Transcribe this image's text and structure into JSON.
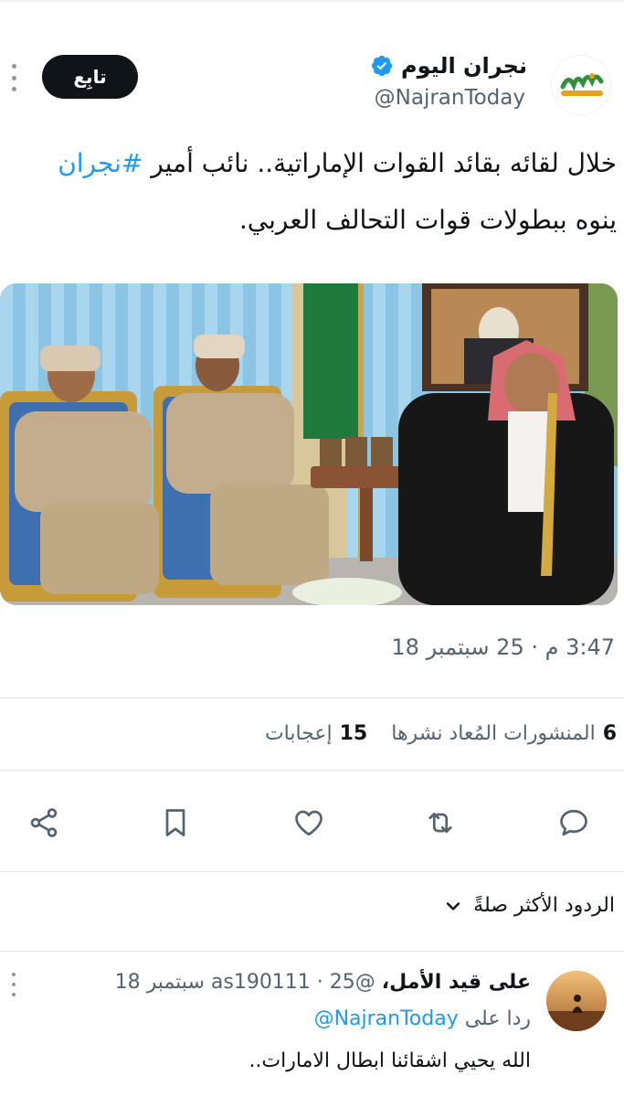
{
  "tweet": {
    "display_name": "نجران اليوم",
    "handle": "@NajranToday",
    "follow_label": "تابِع",
    "avatar_logo": "نجران اليوم",
    "text_line1_prefix": "خلال لقائه بقائد القوات الإماراتية.. نائب أمير ",
    "hashtag": "#نجران",
    "text_line2": "ينوه ببطولات قوات التحالف العربي.",
    "timestamp": "3:47 م · 25 سبتمبر 18",
    "reposts_count": "6",
    "reposts_label": "المنشورات المُعاد نشرها",
    "likes_count": "15",
    "likes_label": "إعجابات"
  },
  "actions": [
    {
      "name": "reply",
      "icon": "reply-icon"
    },
    {
      "name": "repost",
      "icon": "repost-icon"
    },
    {
      "name": "like",
      "icon": "heart-icon"
    },
    {
      "name": "bookmark",
      "icon": "bookmark-icon"
    },
    {
      "name": "share",
      "icon": "share-icon"
    }
  ],
  "replies_sort_label": "الردود الأكثر صلةً",
  "reply": {
    "name": "على قيد الأمل،",
    "meta": "@as190111 · 25 سبتمبر 18",
    "replying_to_prefix": "ردا على",
    "replying_to_handle": "@NajranToday",
    "text": "الله يحيي اشقائنا ابطال الامارات.."
  },
  "colors": {
    "accent": "#1d9bf0",
    "text_primary": "#0f1419",
    "text_secondary": "#536471",
    "follow_button": "#0f1419"
  }
}
